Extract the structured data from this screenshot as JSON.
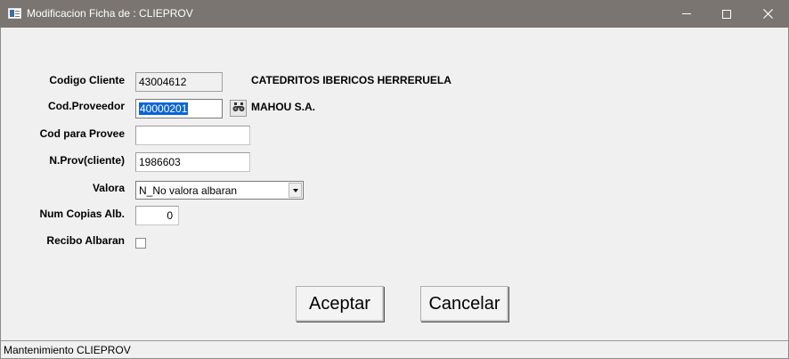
{
  "window": {
    "title": "Modificacion Ficha de : CLIEPROV",
    "icon": "app-window-icon",
    "controls": [
      "minimize-icon",
      "maximize-icon",
      "close-icon"
    ]
  },
  "form": {
    "codigo_cliente": {
      "label": "Codigo Cliente",
      "value": "43004612",
      "name": "CATEDRITOS IBERICOS HERRERUELA"
    },
    "cod_proveedor": {
      "label": "Cod.Proveedor",
      "value": "40000201",
      "name": "MAHOU S.A.",
      "lookup_icon": "binoculars-icon"
    },
    "cod_para_provee": {
      "label": "Cod para Provee",
      "value": ""
    },
    "n_prov_cliente": {
      "label": "N.Prov(cliente)",
      "value": "1986603"
    },
    "valora": {
      "label": "Valora",
      "selected": "N_No valora albaran"
    },
    "num_copias": {
      "label": "Num Copias Alb.",
      "value": "0"
    },
    "recibo_albaran": {
      "label": "Recibo Albaran",
      "checked": false
    }
  },
  "buttons": {
    "accept": "Aceptar",
    "cancel": "Cancelar"
  },
  "status": {
    "text": "Mantenimiento CLIEPROV"
  },
  "colors": {
    "titlebar": "#7a7570",
    "selection": "#0a64d6",
    "background": "#f0f0f0"
  }
}
